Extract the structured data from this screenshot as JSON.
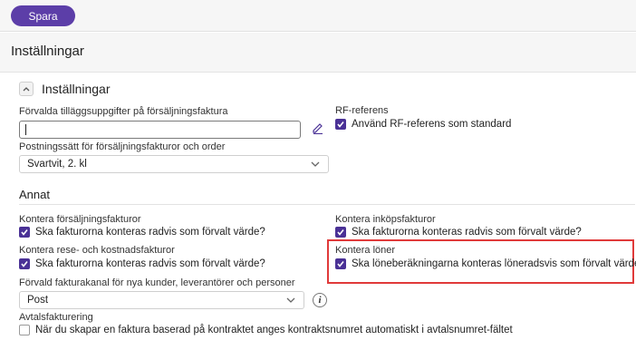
{
  "toolbar": {
    "save_label": "Spara"
  },
  "page": {
    "title": "Inställningar"
  },
  "section": {
    "title": "Inställningar",
    "invoice_extra_label": "Förvalda tilläggsuppgifter på försäljningsfaktura",
    "invoice_extra_value": "",
    "posting_label": "Postningssätt för försäljningsfakturor och order",
    "posting_value": "Svartvit, 2. kl",
    "rf_label": "RF-referens",
    "rf_checkbox_label": "Använd RF-referens som standard",
    "rf_checked": true
  },
  "annat": {
    "title": "Annat",
    "sales_label": "Kontera försäljningsfakturor",
    "sales_checkbox": "Ska fakturorna konteras radvis som förvalt värde?",
    "purchase_label": "Kontera inköpsfakturor",
    "purchase_checkbox": "Ska fakturorna konteras radvis som förvalt värde?",
    "travel_label": "Kontera rese- och kostnadsfakturor",
    "travel_checkbox": "Ska fakturorna konteras radvis som förvalt värde?",
    "salary_label": "Kontera löner",
    "salary_checkbox": "Ska löneberäkningarna konteras löneradsvis som förvalt värde?",
    "channel_label": "Förvald fakturakanal för nya kunder, leverantörer och personer",
    "channel_value": "Post",
    "agreement_label": "Avtalsfakturering",
    "agreement_checkbox": "När du skapar en faktura baserad på kontraktet anges kontraktsnumret automatiskt i avtalsnumret-fältet",
    "agreement_checked": false
  },
  "colors": {
    "accent": "#5c3ea8",
    "checkbox": "#4a3196",
    "highlight": "#e03a3a"
  },
  "icons": [
    "chevron-up-icon",
    "pencil-icon",
    "chevron-down-icon",
    "info-icon",
    "checkmark-icon"
  ]
}
